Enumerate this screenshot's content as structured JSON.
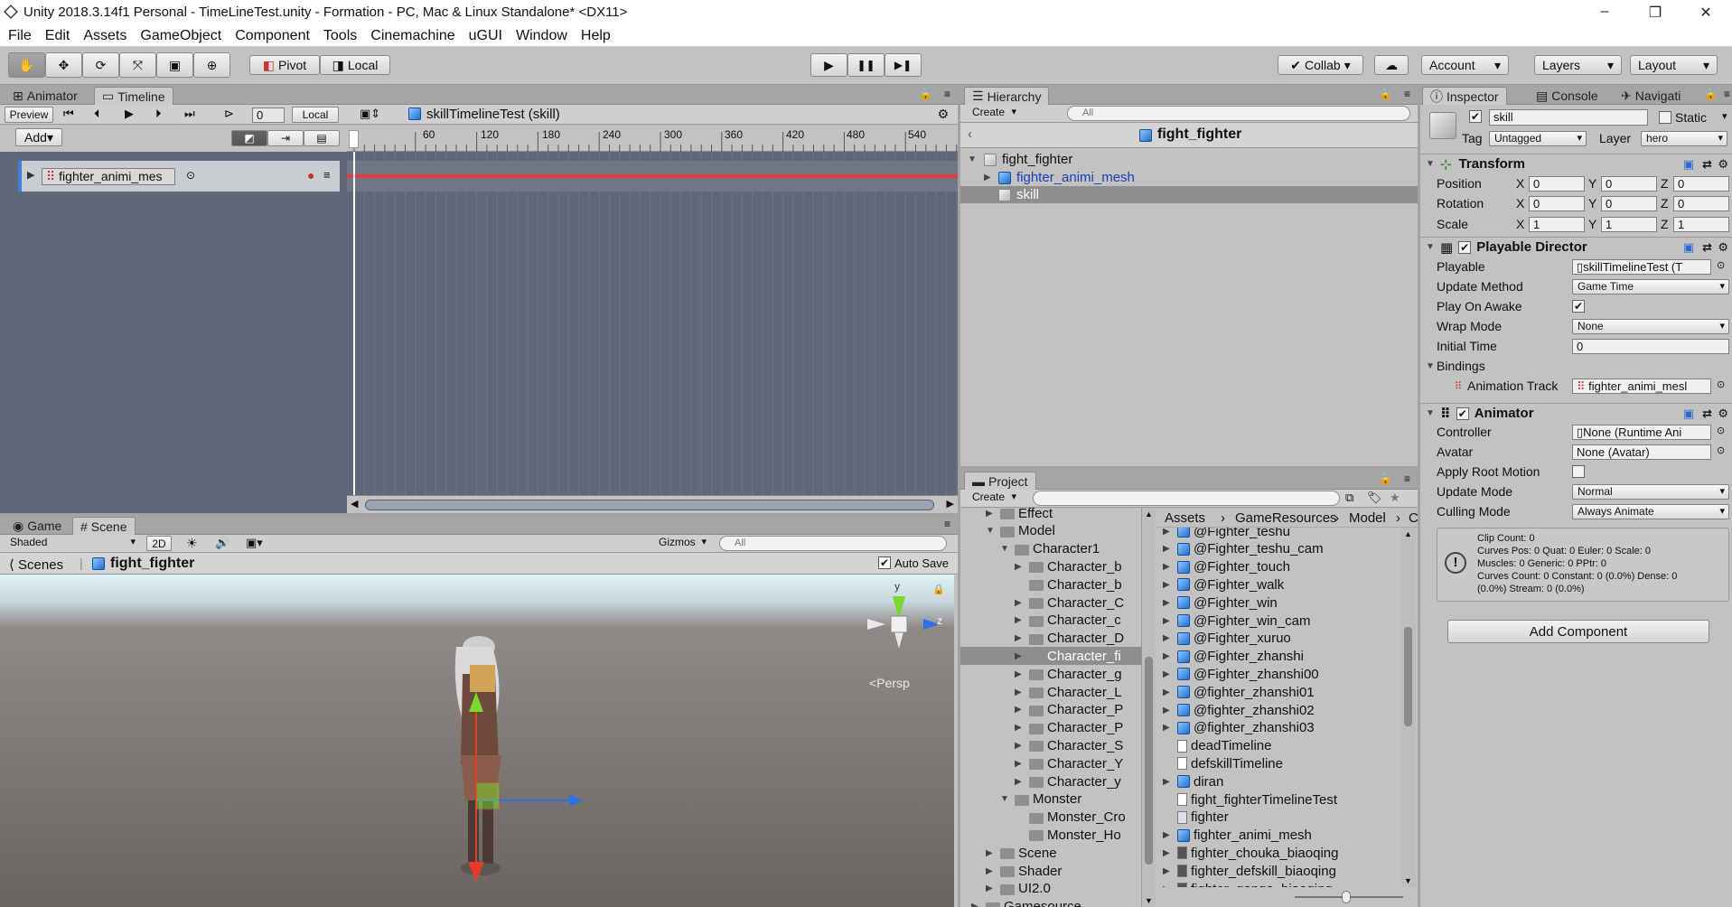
{
  "window": {
    "title": "Unity 2018.3.14f1 Personal - TimeLineTest.unity - Formation - PC, Mac & Linux Standalone* <DX11>",
    "min": "–",
    "max": "❐",
    "close": "✕"
  },
  "menu": [
    "File",
    "Edit",
    "Assets",
    "GameObject",
    "Component",
    "Tools",
    "Cinemachine",
    "uGUI",
    "Window",
    "Help"
  ],
  "toolbar": {
    "pivot": "Pivot",
    "local": "Local",
    "collab": "Collab",
    "account": "Account",
    "layers": "Layers",
    "layout": "Layout",
    "play": "▶",
    "pause": "❚❚",
    "step": "▶❚"
  },
  "timeline": {
    "tabs": [
      "Animator",
      "Timeline"
    ],
    "preview": "Preview",
    "frame": "0",
    "local": "Local",
    "asset": "skillTimelineTest (skill)",
    "add": "Add",
    "ticks": [
      "60",
      "120",
      "180",
      "240",
      "300",
      "360",
      "420",
      "480",
      "540"
    ],
    "track_name": "fighter_animi_mes"
  },
  "scene": {
    "tabs": [
      "Game",
      "Scene"
    ],
    "shading": "Shaded",
    "mode2d": "2D",
    "gizmos": "Gizmos",
    "search_placeholder": "All",
    "breadcrumb_root": "Scenes",
    "breadcrumb_obj": "fight_fighter",
    "autosave": "Auto Save",
    "persp": "<Persp",
    "gizmo_y": "y",
    "gizmo_z": "z"
  },
  "hierarchy": {
    "tab": "Hierarchy",
    "create": "Create",
    "search_placeholder": "All",
    "header": "fight_fighter",
    "rows": [
      {
        "label": "fight_fighter",
        "depth": 0
      },
      {
        "label": "fighter_animi_mesh",
        "depth": 1
      },
      {
        "label": "skill",
        "depth": 1
      }
    ]
  },
  "project": {
    "tab": "Project",
    "create": "Create",
    "breadcrumb": [
      "Assets",
      "GameResources",
      "Model",
      "C"
    ],
    "tree": [
      {
        "label": "Effect",
        "depth": 1
      },
      {
        "label": "Model",
        "depth": 1
      },
      {
        "label": "Character1",
        "depth": 2
      },
      {
        "label": "Character_b",
        "depth": 3
      },
      {
        "label": "Character_b",
        "depth": 3
      },
      {
        "label": "Character_C",
        "depth": 3
      },
      {
        "label": "Character_c",
        "depth": 3
      },
      {
        "label": "Character_D",
        "depth": 3
      },
      {
        "label": "Character_fi",
        "depth": 3
      },
      {
        "label": "Character_g",
        "depth": 3
      },
      {
        "label": "Character_L",
        "depth": 3
      },
      {
        "label": "Character_P",
        "depth": 3
      },
      {
        "label": "Character_P",
        "depth": 3
      },
      {
        "label": "Character_S",
        "depth": 3
      },
      {
        "label": "Character_Y",
        "depth": 3
      },
      {
        "label": "Character_y",
        "depth": 3
      },
      {
        "label": "Monster",
        "depth": 2
      },
      {
        "label": "Monster_Cro",
        "depth": 3
      },
      {
        "label": "Monster_Ho",
        "depth": 3
      },
      {
        "label": "Scene",
        "depth": 1
      },
      {
        "label": "Shader",
        "depth": 1
      },
      {
        "label": "UI2.0",
        "depth": 1
      },
      {
        "label": "Gamesource",
        "depth": 0
      }
    ],
    "assets": [
      "@Fighter_teshu",
      "@Fighter_teshu_cam",
      "@Fighter_touch",
      "@Fighter_walk",
      "@Fighter_win",
      "@Fighter_win_cam",
      "@Fighter_xuruo",
      "@Fighter_zhanshi",
      "@Fighter_zhanshi00",
      "@fighter_zhanshi01",
      "@fighter_zhanshi02",
      "@fighter_zhanshi03",
      "deadTimeline",
      "defskillTimeline",
      "diran",
      "fight_fighterTimelineTest",
      "fighter",
      "fighter_animi_mesh",
      "fighter_chouka_biaoqing",
      "fighter_defskill_biaoqing",
      "fighter_ganga_biaoqing"
    ]
  },
  "inspector": {
    "tabs": [
      "Inspector",
      "Console",
      "Navigati"
    ],
    "name": "skill",
    "static": "Static",
    "tag_label": "Tag",
    "tag": "Untagged",
    "layer_label": "Layer",
    "layer": "hero",
    "transform": {
      "title": "Transform",
      "position_label": "Position",
      "rotation_label": "Rotation",
      "scale_label": "Scale",
      "position": [
        "0",
        "0",
        "0"
      ],
      "rotation": [
        "0",
        "0",
        "0"
      ],
      "scale": [
        "1",
        "1",
        "1"
      ],
      "x": "X",
      "y": "Y",
      "z": "Z"
    },
    "director": {
      "title": "Playable Director",
      "playable_label": "Playable",
      "playable": "skillTimelineTest (T",
      "update_label": "Update Method",
      "update": "Game Time",
      "awake_label": "Play On Awake",
      "wrap_label": "Wrap Mode",
      "wrap": "None",
      "time_label": "Initial Time",
      "time": "0",
      "bindings_label": "Bindings",
      "track_label": "Animation Track",
      "track": "fighter_animi_mesl"
    },
    "animator": {
      "title": "Animator",
      "controller_label": "Controller",
      "controller": "None (Runtime Ani",
      "avatar_label": "Avatar",
      "avatar": "None (Avatar)",
      "root_label": "Apply Root Motion",
      "mode_label": "Update Mode",
      "mode": "Normal",
      "culling_label": "Culling Mode",
      "culling": "Always Animate",
      "info": [
        "Clip Count: 0",
        "Curves Pos: 0 Quat: 0 Euler: 0 Scale: 0",
        "Muscles: 0 Generic: 0 PPtr: 0",
        "Curves Count: 0 Constant: 0 (0.0%) Dense: 0",
        "(0.0%) Stream: 0 (0.0%)"
      ]
    },
    "add_component": "Add Component"
  }
}
